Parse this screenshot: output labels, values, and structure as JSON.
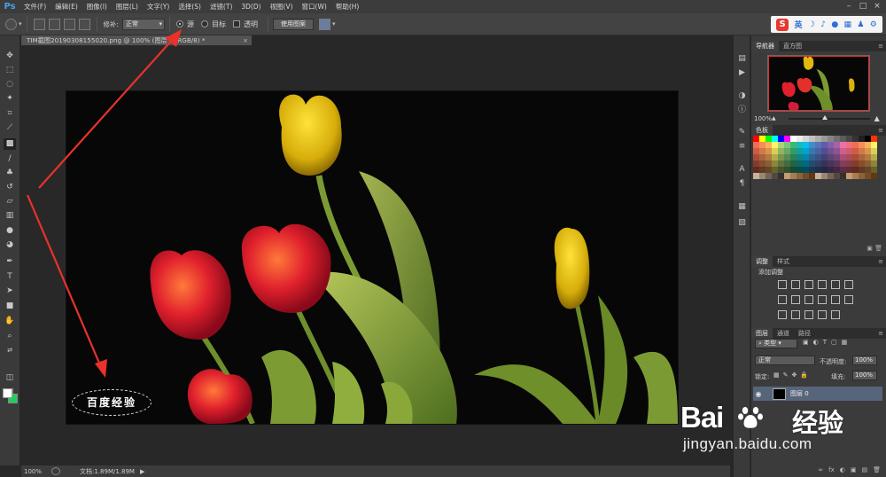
{
  "app": {
    "logo": "Ps",
    "menu": [
      "文件(F)",
      "编辑(E)",
      "图像(I)",
      "图层(L)",
      "文字(Y)",
      "选择(S)",
      "滤镜(T)",
      "3D(D)",
      "视图(V)",
      "窗口(W)",
      "帮助(H)"
    ],
    "window_controls": [
      "–",
      "□",
      "×"
    ]
  },
  "options_bar": {
    "patch_label": "修补:",
    "patch_mode": "正常",
    "source_label": "源",
    "destination_label": "目标",
    "transparent_label": "透明",
    "use_pattern_label": "使用图案"
  },
  "ime": {
    "logo": "S",
    "lang": "英",
    "icons": [
      "☽",
      "♪",
      "●",
      "▦",
      "♟",
      "⚙"
    ]
  },
  "document": {
    "tab_title": "TIM截图20190308155020.png @ 100% (图层 0, RGB/8) *",
    "close": "×",
    "watermark": "百度经验"
  },
  "status_bar": {
    "zoom": "100%",
    "doc_info": "文档:1.89M/1.89M",
    "arrow": "▶"
  },
  "panels": {
    "navigator": {
      "tabs": [
        "导航器",
        "直方图"
      ],
      "zoom": "100%"
    },
    "swatches": {
      "tabs": [
        "色板"
      ]
    },
    "adjustments": {
      "tabs": [
        "调整",
        "样式"
      ],
      "title": "添加调整"
    },
    "layers": {
      "tabs": [
        "图层",
        "通道",
        "路径"
      ],
      "kind": "类型",
      "blend_mode": "正常",
      "opacity_label": "不透明度:",
      "opacity": "100%",
      "lock_label": "锁定:",
      "fill_label": "填充:",
      "fill": "100%",
      "layer_name": "图层 0",
      "footer_icons": [
        "∞",
        "fx",
        "◐",
        "▣",
        "▤",
        "🗑"
      ]
    }
  },
  "baidu_watermark": {
    "logo_left": "Bai",
    "logo_right": "经验",
    "url": "jingyan.baidu.com"
  },
  "colors": {
    "ps_blue": "#49a0e8",
    "arrow_red": "#e8322b",
    "background_swatch": "#1ecf5a",
    "foreground_swatch": "#ffffff",
    "layer_highlight": "#57657a"
  }
}
